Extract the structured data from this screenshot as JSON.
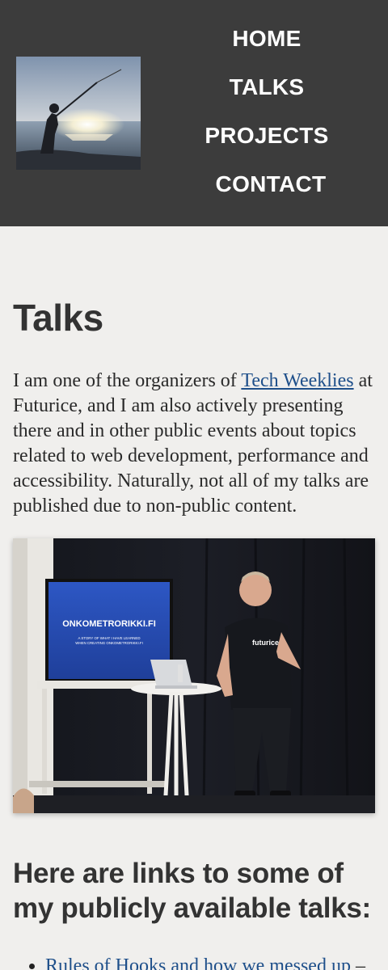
{
  "nav": {
    "items": [
      "HOME",
      "TALKS",
      "PROJECTS",
      "CONTACT"
    ]
  },
  "page": {
    "title": "Talks",
    "intro_before": "I am one of the organizers of ",
    "intro_link": "Tech Weeklies",
    "intro_after": " at Futurice, and I am also actively presenting there and in other public events about topics related to web development, performance and accessibility. Naturally, not all of my talks are published due to non-public content.",
    "slide_title": "ONKOMETRORIKKI.FI",
    "slide_sub1": "A STORY OF WHAT I HAVE LEARNED",
    "slide_sub2": "WHEN CREATING ONKOMETRORIKKI.FI",
    "shirt_text": "futurice",
    "links_heading": "Here are links to some of my publicly available talks:",
    "talks": [
      {
        "title": "Rules of Hooks and how we messed up",
        "suffix": " –"
      }
    ]
  },
  "colors": {
    "header_bg": "#3c3c3c",
    "page_bg": "#f0efed",
    "link": "#1e4f8a",
    "text": "#2a2a2a"
  }
}
